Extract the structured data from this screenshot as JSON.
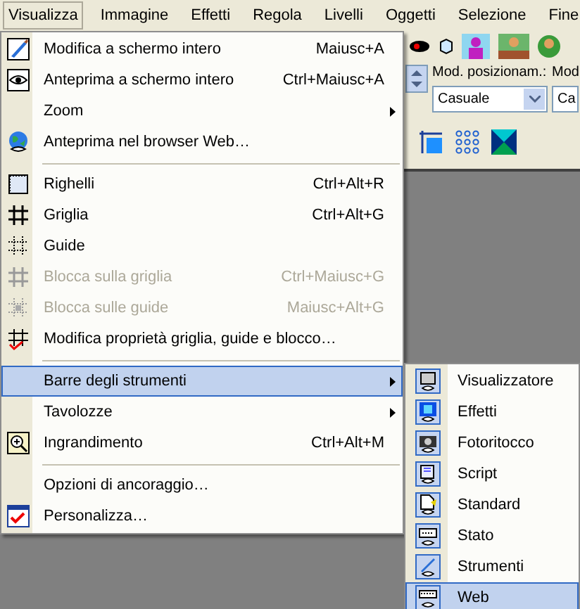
{
  "menubar": [
    {
      "label": "Visualizza",
      "selected": true
    },
    {
      "label": "Immagine",
      "selected": false
    },
    {
      "label": "Effetti",
      "selected": false
    },
    {
      "label": "Regola",
      "selected": false
    },
    {
      "label": "Livelli",
      "selected": false
    },
    {
      "label": "Oggetti",
      "selected": false
    },
    {
      "label": "Selezione",
      "selected": false
    },
    {
      "label": "Fine",
      "selected": false
    }
  ],
  "toolbar": {
    "fields": [
      {
        "label": "Mod. posizionam.:",
        "value": "Casuale"
      },
      {
        "label": "Mod",
        "value": "Ca"
      }
    ]
  },
  "menu": [
    {
      "kind": "item",
      "label": "Modifica a schermo intero",
      "shortcut": "Maiusc+A",
      "disabled": false,
      "selected": false,
      "submenu": false
    },
    {
      "kind": "item",
      "label": "Anteprima a schermo intero",
      "shortcut": "Ctrl+Maiusc+A",
      "disabled": false,
      "selected": false,
      "submenu": false
    },
    {
      "kind": "item",
      "label": "Zoom",
      "disabled": false,
      "selected": false,
      "submenu": true
    },
    {
      "kind": "item",
      "label": "Anteprima nel browser Web…",
      "disabled": false,
      "selected": false,
      "submenu": false
    },
    {
      "kind": "separator"
    },
    {
      "kind": "item",
      "label": "Righelli",
      "shortcut": "Ctrl+Alt+R",
      "disabled": false,
      "selected": false,
      "submenu": false
    },
    {
      "kind": "item",
      "label": "Griglia",
      "shortcut": "Ctrl+Alt+G",
      "disabled": false,
      "selected": false,
      "submenu": false
    },
    {
      "kind": "item",
      "label": "Guide",
      "disabled": false,
      "selected": false,
      "submenu": false
    },
    {
      "kind": "item",
      "label": "Blocca sulla griglia",
      "shortcut": "Ctrl+Maiusc+G",
      "disabled": true,
      "selected": false,
      "submenu": false
    },
    {
      "kind": "item",
      "label": "Blocca sulle guide",
      "shortcut": "Maiusc+Alt+G",
      "disabled": true,
      "selected": false,
      "submenu": false
    },
    {
      "kind": "item",
      "label": "Modifica proprietà griglia, guide e blocco…",
      "disabled": false,
      "selected": false,
      "submenu": false
    },
    {
      "kind": "separator"
    },
    {
      "kind": "item",
      "label": "Barre degli strumenti",
      "disabled": false,
      "selected": true,
      "submenu": true
    },
    {
      "kind": "item",
      "label": "Tavolozze",
      "disabled": false,
      "selected": false,
      "submenu": true
    },
    {
      "kind": "item",
      "label": "Ingrandimento",
      "shortcut": "Ctrl+Alt+M",
      "disabled": false,
      "selected": false,
      "submenu": false
    },
    {
      "kind": "separator"
    },
    {
      "kind": "item",
      "label": "Opzioni di ancoraggio…",
      "disabled": false,
      "selected": false,
      "submenu": false
    },
    {
      "kind": "item",
      "label": "Personalizza…",
      "disabled": false,
      "selected": false,
      "submenu": false
    }
  ],
  "submenu": [
    {
      "label": "Visualizzatore",
      "selected": false
    },
    {
      "label": "Effetti",
      "selected": false
    },
    {
      "label": "Fotoritocco",
      "selected": false
    },
    {
      "label": "Script",
      "selected": false
    },
    {
      "label": "Standard",
      "selected": false
    },
    {
      "label": "Stato",
      "selected": false
    },
    {
      "label": "Strumenti",
      "selected": false
    },
    {
      "label": "Web",
      "selected": true
    }
  ]
}
